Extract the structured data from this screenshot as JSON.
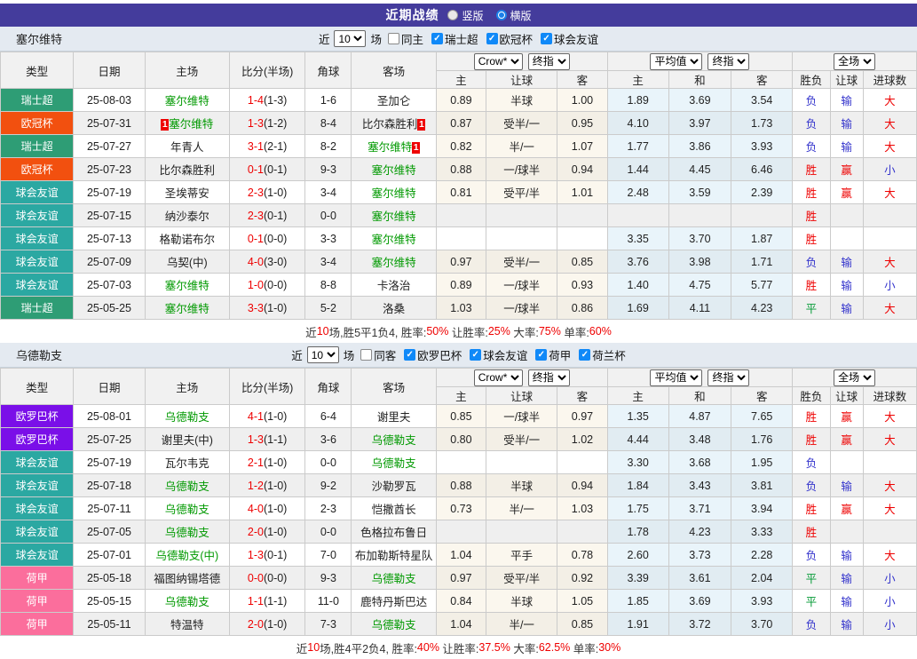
{
  "titlebar": {
    "title": "近期战绩",
    "radio_vertical": "竖版",
    "radio_horizontal": "横版",
    "selected": "横版"
  },
  "table_header": {
    "cols": [
      "类型",
      "日期",
      "主场",
      "比分(半场)",
      "角球",
      "客场"
    ],
    "sub": [
      "主",
      "让球",
      "客",
      "主",
      "和",
      "客",
      "胜负",
      "让球",
      "进球数"
    ],
    "odds_source": "Crow*",
    "odds_time": "终指",
    "avg_source": "平均值",
    "avg_time": "终指",
    "scope": "全场"
  },
  "type_colors": {
    "瑞士超": "#2E9D75",
    "欧冠杯": "#F2500F",
    "球会友谊": "#2BA8A2",
    "欧罗巴杯": "#7A0FE8",
    "荷甲": "#FB6E9C"
  },
  "result_colors": {
    "胜": "#EE0000",
    "赢": "#EE0000",
    "大": "#EE0000",
    "平": "#009933",
    "负": "#3333CC",
    "输": "#3333CC",
    "小": "#3333CC"
  },
  "sections": [
    {
      "team": "塞尔维特",
      "filter": {
        "prefix": "近",
        "count": "10",
        "suffix": "场",
        "same": {
          "label": "同主",
          "checked": false
        },
        "leagues": [
          {
            "label": "瑞士超",
            "checked": true
          },
          {
            "label": "欧冠杯",
            "checked": true
          },
          {
            "label": "球会友谊",
            "checked": true
          }
        ]
      },
      "rows": [
        {
          "type": "瑞士超",
          "date": "25-08-03",
          "home": {
            "name": "塞尔维特",
            "self": true
          },
          "score": "1-4",
          "half": "(1-3)",
          "corner": "1-6",
          "away": {
            "name": "圣加仑",
            "self": false
          },
          "odds": [
            "0.89",
            "半球",
            "1.00"
          ],
          "avg": [
            "1.89",
            "3.69",
            "3.54"
          ],
          "result": [
            "负",
            "输",
            "大"
          ]
        },
        {
          "type": "欧冠杯",
          "date": "25-07-31",
          "home": {
            "name": "塞尔维特",
            "self": true,
            "card_pre": "1"
          },
          "score": "1-3",
          "half": "(1-2)",
          "corner": "8-4",
          "away": {
            "name": "比尔森胜利",
            "self": false,
            "card_post": "1"
          },
          "odds": [
            "0.87",
            "受半/一",
            "0.95"
          ],
          "avg": [
            "4.10",
            "3.97",
            "1.73"
          ],
          "result": [
            "负",
            "输",
            "大"
          ]
        },
        {
          "type": "瑞士超",
          "date": "25-07-27",
          "home": {
            "name": "年青人",
            "self": false
          },
          "score": "3-1",
          "half": "(2-1)",
          "corner": "8-2",
          "away": {
            "name": "塞尔维特",
            "self": true,
            "card_post": "1"
          },
          "odds": [
            "0.82",
            "半/一",
            "1.07"
          ],
          "avg": [
            "1.77",
            "3.86",
            "3.93"
          ],
          "result": [
            "负",
            "输",
            "大"
          ]
        },
        {
          "type": "欧冠杯",
          "date": "25-07-23",
          "home": {
            "name": "比尔森胜利",
            "self": false
          },
          "score": "0-1",
          "half": "(0-1)",
          "corner": "9-3",
          "away": {
            "name": "塞尔维特",
            "self": true
          },
          "odds": [
            "0.88",
            "一/球半",
            "0.94"
          ],
          "avg": [
            "1.44",
            "4.45",
            "6.46"
          ],
          "result": [
            "胜",
            "赢",
            "小"
          ]
        },
        {
          "type": "球会友谊",
          "date": "25-07-19",
          "home": {
            "name": "圣埃蒂安",
            "self": false
          },
          "score": "2-3",
          "half": "(1-0)",
          "corner": "3-4",
          "away": {
            "name": "塞尔维特",
            "self": true
          },
          "odds": [
            "0.81",
            "受平/半",
            "1.01"
          ],
          "avg": [
            "2.48",
            "3.59",
            "2.39"
          ],
          "result": [
            "胜",
            "赢",
            "大"
          ]
        },
        {
          "type": "球会友谊",
          "date": "25-07-15",
          "home": {
            "name": "纳沙泰尔",
            "self": false
          },
          "score": "2-3",
          "half": "(0-1)",
          "corner": "0-0",
          "away": {
            "name": "塞尔维特",
            "self": true
          },
          "odds": [
            "",
            "",
            ""
          ],
          "avg": [
            "",
            "",
            ""
          ],
          "result": [
            "胜",
            "",
            ""
          ]
        },
        {
          "type": "球会友谊",
          "date": "25-07-13",
          "home": {
            "name": "格勒诺布尔",
            "self": false
          },
          "score": "0-1",
          "half": "(0-0)",
          "corner": "3-3",
          "away": {
            "name": "塞尔维特",
            "self": true
          },
          "odds": [
            "",
            "",
            ""
          ],
          "avg": [
            "3.35",
            "3.70",
            "1.87"
          ],
          "result": [
            "胜",
            "",
            ""
          ]
        },
        {
          "type": "球会友谊",
          "date": "25-07-09",
          "home": {
            "name": "乌契(中)",
            "self": false
          },
          "score": "4-0",
          "half": "(3-0)",
          "corner": "3-4",
          "away": {
            "name": "塞尔维特",
            "self": true
          },
          "odds": [
            "0.97",
            "受半/一",
            "0.85"
          ],
          "avg": [
            "3.76",
            "3.98",
            "1.71"
          ],
          "result": [
            "负",
            "输",
            "大"
          ]
        },
        {
          "type": "球会友谊",
          "date": "25-07-03",
          "home": {
            "name": "塞尔维特",
            "self": true
          },
          "score": "1-0",
          "half": "(0-0)",
          "corner": "8-8",
          "away": {
            "name": "卡洛治",
            "self": false
          },
          "odds": [
            "0.89",
            "一/球半",
            "0.93"
          ],
          "avg": [
            "1.40",
            "4.75",
            "5.77"
          ],
          "result": [
            "胜",
            "输",
            "小"
          ]
        },
        {
          "type": "瑞士超",
          "date": "25-05-25",
          "home": {
            "name": "塞尔维特",
            "self": true
          },
          "score": "3-3",
          "half": "(1-0)",
          "corner": "5-2",
          "away": {
            "name": "洛桑",
            "self": false
          },
          "odds": [
            "1.03",
            "一/球半",
            "0.86"
          ],
          "avg": [
            "1.69",
            "4.11",
            "4.23"
          ],
          "result": [
            "平",
            "输",
            "大"
          ]
        }
      ],
      "summary": [
        {
          "t": "近",
          "c": "d"
        },
        {
          "t": "10",
          "c": "r"
        },
        {
          "t": "场,胜5平1负4, 胜率:",
          "c": "d"
        },
        {
          "t": "50%",
          "c": "r"
        },
        {
          "t": " 让胜率:",
          "c": "d"
        },
        {
          "t": "25%",
          "c": "r"
        },
        {
          "t": " 大率:",
          "c": "d"
        },
        {
          "t": "75%",
          "c": "r"
        },
        {
          "t": " 单率:",
          "c": "d"
        },
        {
          "t": "60%",
          "c": "r"
        }
      ]
    },
    {
      "team": "乌德勒支",
      "filter": {
        "prefix": "近",
        "count": "10",
        "suffix": "场",
        "same": {
          "label": "同客",
          "checked": false
        },
        "leagues": [
          {
            "label": "欧罗巴杯",
            "checked": true
          },
          {
            "label": "球会友谊",
            "checked": true
          },
          {
            "label": "荷甲",
            "checked": true
          },
          {
            "label": "荷兰杯",
            "checked": true
          }
        ]
      },
      "rows": [
        {
          "type": "欧罗巴杯",
          "date": "25-08-01",
          "home": {
            "name": "乌德勒支",
            "self": true
          },
          "score": "4-1",
          "half": "(1-0)",
          "corner": "6-4",
          "away": {
            "name": "谢里夫",
            "self": false
          },
          "odds": [
            "0.85",
            "一/球半",
            "0.97"
          ],
          "avg": [
            "1.35",
            "4.87",
            "7.65"
          ],
          "result": [
            "胜",
            "赢",
            "大"
          ]
        },
        {
          "type": "欧罗巴杯",
          "date": "25-07-25",
          "home": {
            "name": "谢里夫(中)",
            "self": false
          },
          "score": "1-3",
          "half": "(1-1)",
          "corner": "3-6",
          "away": {
            "name": "乌德勒支",
            "self": true
          },
          "odds": [
            "0.80",
            "受半/一",
            "1.02"
          ],
          "avg": [
            "4.44",
            "3.48",
            "1.76"
          ],
          "result": [
            "胜",
            "赢",
            "大"
          ]
        },
        {
          "type": "球会友谊",
          "date": "25-07-19",
          "home": {
            "name": "瓦尔韦克",
            "self": false
          },
          "score": "2-1",
          "half": "(1-0)",
          "corner": "0-0",
          "away": {
            "name": "乌德勒支",
            "self": true
          },
          "odds": [
            "",
            "",
            ""
          ],
          "avg": [
            "3.30",
            "3.68",
            "1.95"
          ],
          "result": [
            "负",
            "",
            ""
          ]
        },
        {
          "type": "球会友谊",
          "date": "25-07-18",
          "home": {
            "name": "乌德勒支",
            "self": true
          },
          "score": "1-2",
          "half": "(1-0)",
          "corner": "9-2",
          "away": {
            "name": "沙勒罗瓦",
            "self": false
          },
          "odds": [
            "0.88",
            "半球",
            "0.94"
          ],
          "avg": [
            "1.84",
            "3.43",
            "3.81"
          ],
          "result": [
            "负",
            "输",
            "大"
          ]
        },
        {
          "type": "球会友谊",
          "date": "25-07-11",
          "home": {
            "name": "乌德勒支",
            "self": true
          },
          "score": "4-0",
          "half": "(1-0)",
          "corner": "2-3",
          "away": {
            "name": "恺撒酋长",
            "self": false
          },
          "odds": [
            "0.73",
            "半/一",
            "1.03"
          ],
          "avg": [
            "1.75",
            "3.71",
            "3.94"
          ],
          "result": [
            "胜",
            "赢",
            "大"
          ]
        },
        {
          "type": "球会友谊",
          "date": "25-07-05",
          "home": {
            "name": "乌德勒支",
            "self": true
          },
          "score": "2-0",
          "half": "(1-0)",
          "corner": "0-0",
          "away": {
            "name": "色格拉布鲁日",
            "self": false
          },
          "odds": [
            "",
            "",
            ""
          ],
          "avg": [
            "1.78",
            "4.23",
            "3.33"
          ],
          "result": [
            "胜",
            "",
            ""
          ]
        },
        {
          "type": "球会友谊",
          "date": "25-07-01",
          "home": {
            "name": "乌德勒支(中)",
            "self": true
          },
          "score": "1-3",
          "half": "(0-1)",
          "corner": "7-0",
          "away": {
            "name": "布加勒斯特星队",
            "self": false
          },
          "odds": [
            "1.04",
            "平手",
            "0.78"
          ],
          "avg": [
            "2.60",
            "3.73",
            "2.28"
          ],
          "result": [
            "负",
            "输",
            "大"
          ]
        },
        {
          "type": "荷甲",
          "date": "25-05-18",
          "home": {
            "name": "福图纳锡塔德",
            "self": false
          },
          "score": "0-0",
          "half": "(0-0)",
          "corner": "9-3",
          "away": {
            "name": "乌德勒支",
            "self": true
          },
          "odds": [
            "0.97",
            "受平/半",
            "0.92"
          ],
          "avg": [
            "3.39",
            "3.61",
            "2.04"
          ],
          "result": [
            "平",
            "输",
            "小"
          ]
        },
        {
          "type": "荷甲",
          "date": "25-05-15",
          "home": {
            "name": "乌德勒支",
            "self": true
          },
          "score": "1-1",
          "half": "(1-1)",
          "corner": "11-0",
          "away": {
            "name": "鹿特丹斯巴达",
            "self": false
          },
          "odds": [
            "0.84",
            "半球",
            "1.05"
          ],
          "avg": [
            "1.85",
            "3.69",
            "3.93"
          ],
          "result": [
            "平",
            "输",
            "小"
          ]
        },
        {
          "type": "荷甲",
          "date": "25-05-11",
          "home": {
            "name": "特温特",
            "self": false
          },
          "score": "2-0",
          "half": "(1-0)",
          "corner": "7-3",
          "away": {
            "name": "乌德勒支",
            "self": true
          },
          "odds": [
            "1.04",
            "半/一",
            "0.85"
          ],
          "avg": [
            "1.91",
            "3.72",
            "3.70"
          ],
          "result": [
            "负",
            "输",
            "小"
          ]
        }
      ],
      "summary": [
        {
          "t": "近",
          "c": "d"
        },
        {
          "t": "10",
          "c": "r"
        },
        {
          "t": "场,胜4平2负4, 胜率:",
          "c": "d"
        },
        {
          "t": "40%",
          "c": "r"
        },
        {
          "t": " 让胜率:",
          "c": "d"
        },
        {
          "t": "37.5%",
          "c": "r"
        },
        {
          "t": " 大率:",
          "c": "d"
        },
        {
          "t": "62.5%",
          "c": "r"
        },
        {
          "t": " 单率:",
          "c": "d"
        },
        {
          "t": "30%",
          "c": "r"
        }
      ]
    }
  ]
}
